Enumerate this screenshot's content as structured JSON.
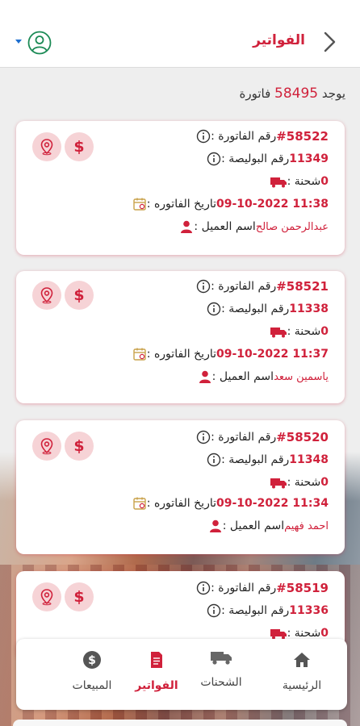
{
  "header": {
    "title": "الفواتير",
    "back_icon": "chevron-right-icon",
    "avatar_icon": "user-circle-icon",
    "caret_icon": "caret-down-icon"
  },
  "summary": {
    "prefix": "يوجد",
    "count": "58495",
    "suffix": "فاتورة"
  },
  "labels": {
    "invoice_no": "رقم الفاتورة :",
    "policy_no": "رقم البوليصة :",
    "shipment": "شحنة :",
    "invoice_date": "تاريخ الفاتوره :",
    "client_name": "اسم العميل :"
  },
  "invoices": [
    {
      "invoice_no": "#58522",
      "policy_no": "11349",
      "shipment": "0",
      "date": "09-10-2022 11:38",
      "client": "عبدالرحمن صالح"
    },
    {
      "invoice_no": "#58521",
      "policy_no": "11338",
      "shipment": "0",
      "date": "09-10-2022 11:37",
      "client": "ياسمين سعد"
    },
    {
      "invoice_no": "#58520",
      "policy_no": "11348",
      "shipment": "0",
      "date": "09-10-2022 11:34",
      "client": "احمد فهيم"
    },
    {
      "invoice_no": "#58519",
      "policy_no": "11336",
      "shipment": "0"
    }
  ],
  "card_actions": {
    "pay_symbol": "$",
    "pay_icon": "dollar-icon",
    "location_icon": "map-pin-icon"
  },
  "bottom_nav": {
    "home": "الرئيسية",
    "shipments": "الشحنات",
    "invoices": "الفواتير",
    "sales": "المبيعات",
    "active": "invoices"
  },
  "colors": {
    "accent": "#d0213b",
    "accent_soft": "#f6d3d6",
    "background": "#eeeeee"
  }
}
